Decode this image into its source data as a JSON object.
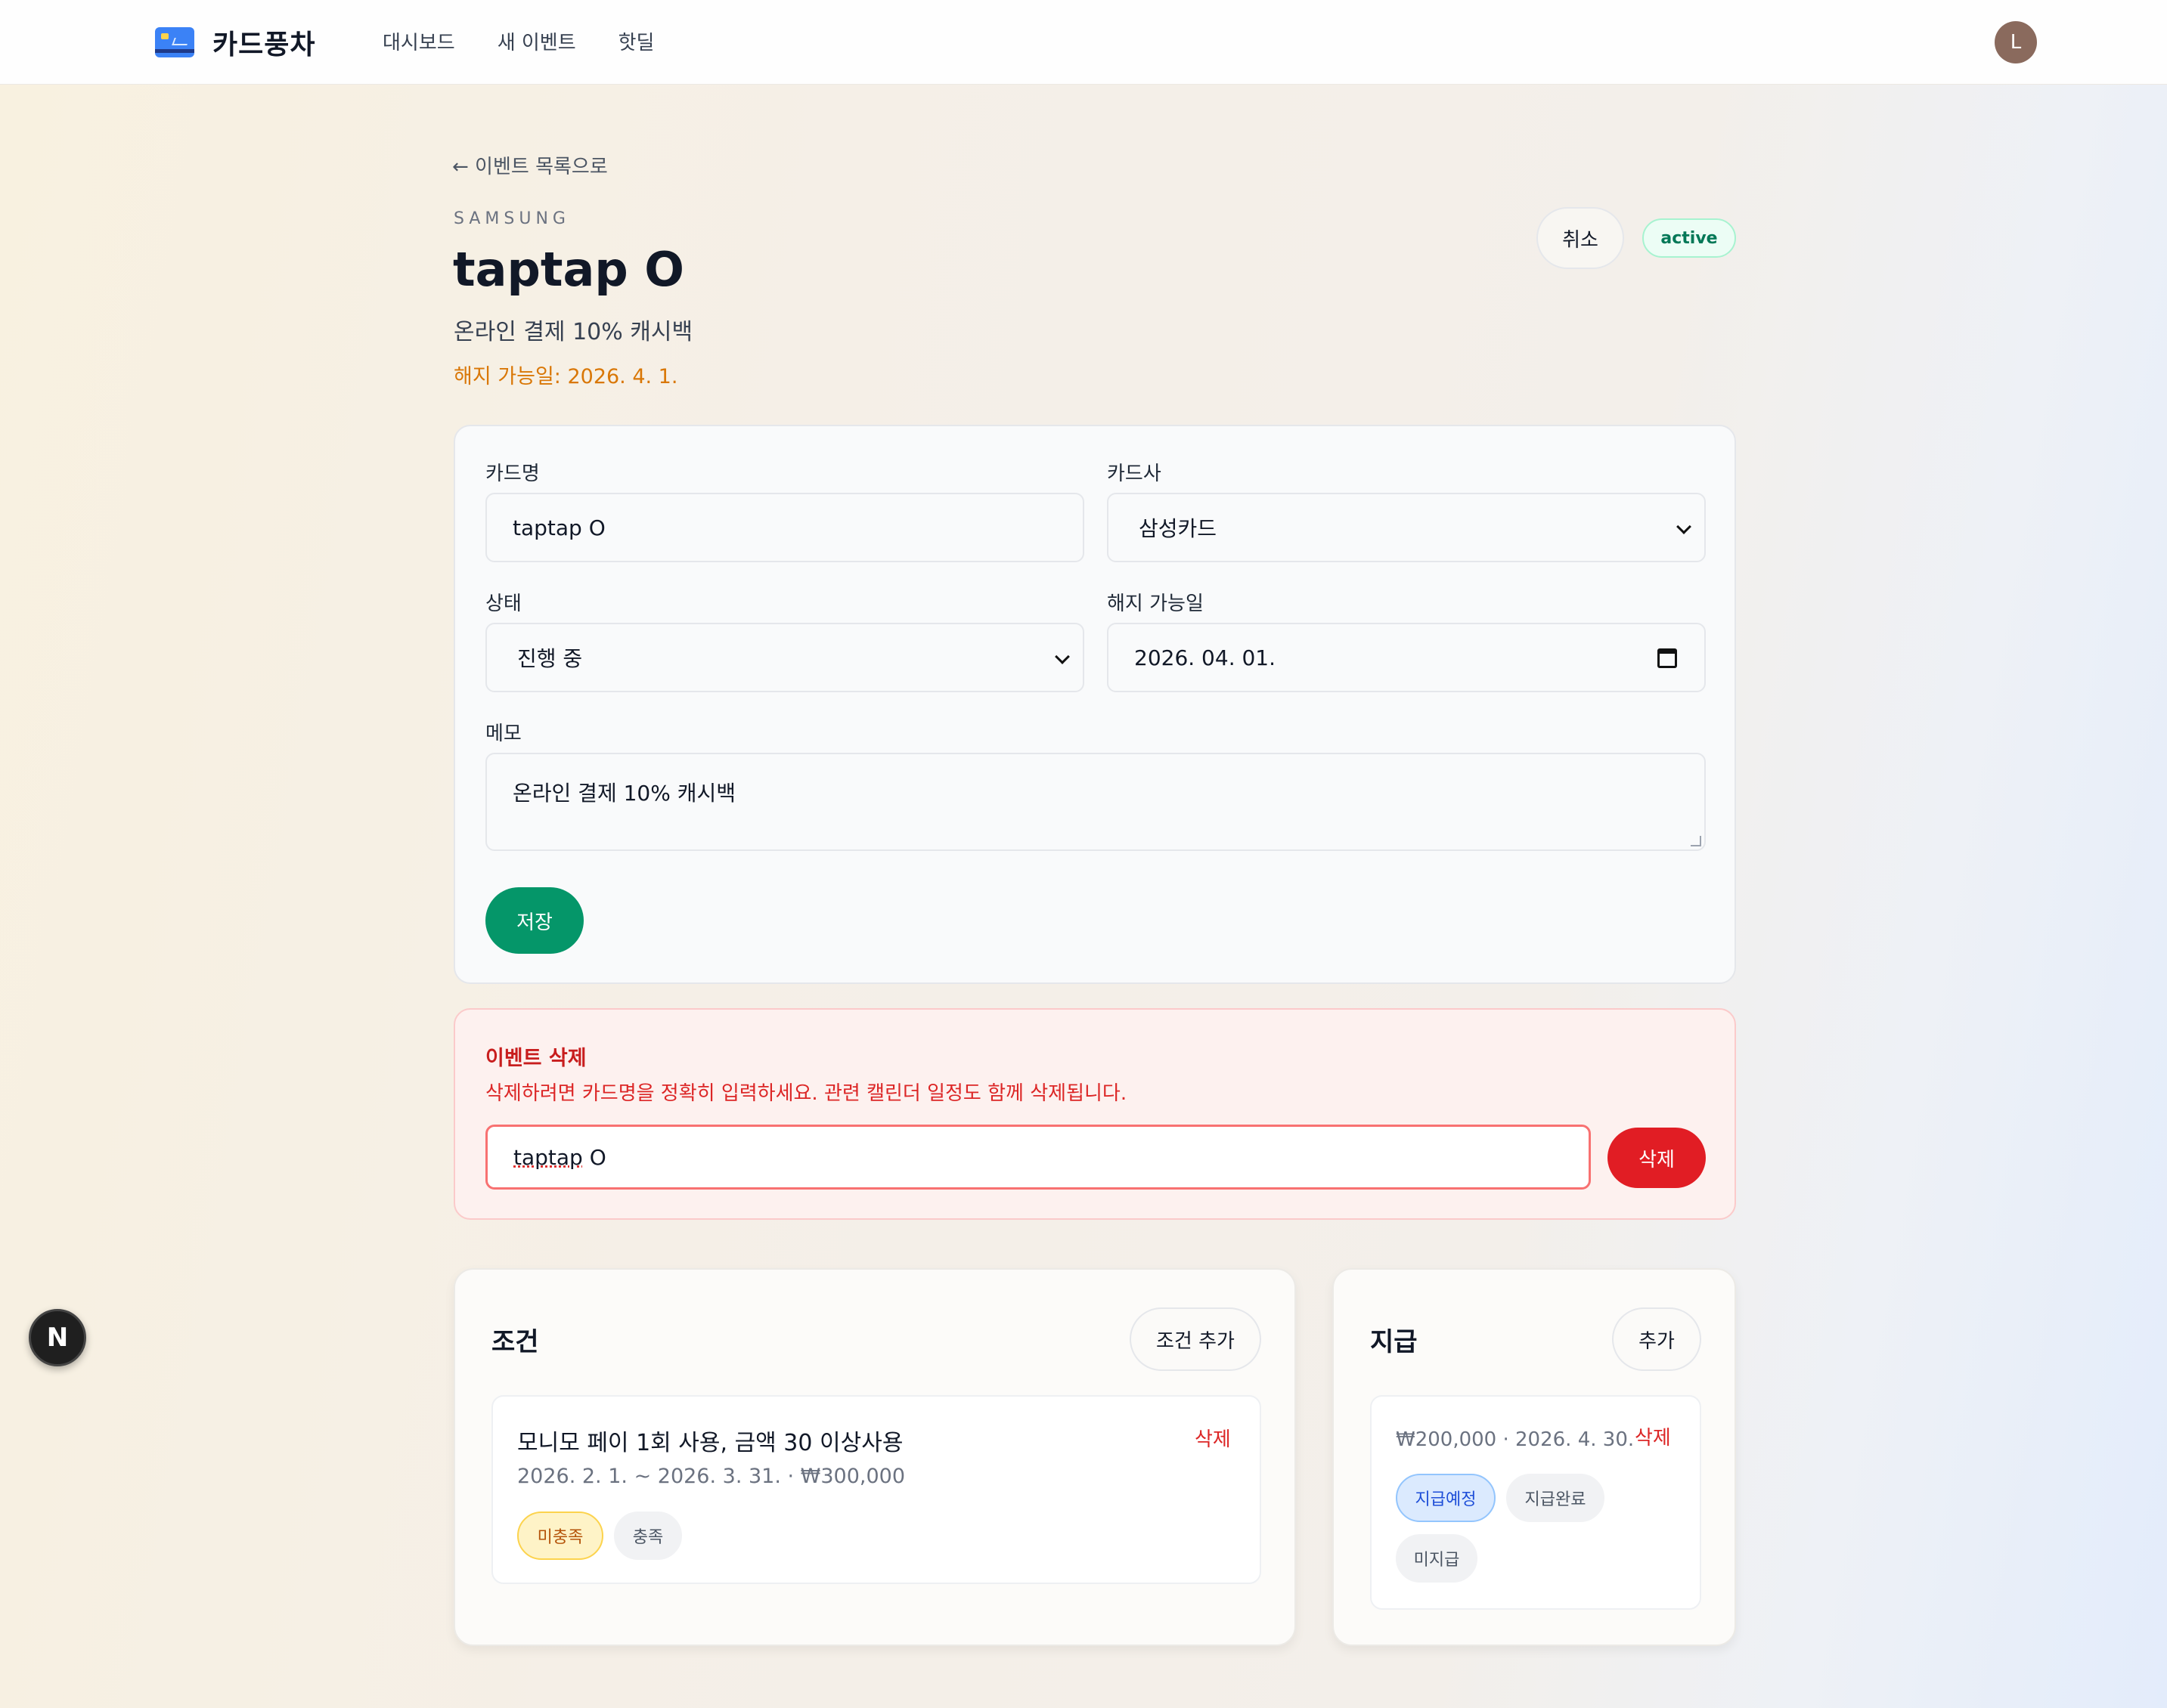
{
  "app": {
    "brand": "카드풍차"
  },
  "nav": {
    "items": [
      "대시보드",
      "새 이벤트",
      "핫딜"
    ]
  },
  "user": {
    "avatar_initial": "L"
  },
  "header": {
    "back_link": "← 이벤트 목록으로",
    "issuer": "SAMSUNG",
    "title": "taptap O",
    "subtitle": "온라인 결제 10% 캐시백",
    "cancel_date": "해지 가능일: 2026. 4. 1.",
    "cancel_button": "취소",
    "status": "active"
  },
  "form": {
    "card_name_label": "카드명",
    "card_name_value": "taptap O",
    "issuer_label": "카드사",
    "issuer_value": "삼성카드",
    "status_label": "상태",
    "status_value": "진행 중",
    "cancel_date_label": "해지 가능일",
    "cancel_date_value": "2026. 04. 01.",
    "memo_label": "메모",
    "memo_value": "온라인 결제 10% 캐시백",
    "save_button": "저장"
  },
  "delete_section": {
    "title": "이벤트 삭제",
    "description": "삭제하려면 카드명을 정확히 입력하세요. 관련 캘린더 일정도 함께 삭제됩니다.",
    "input_value_part1": "taptap",
    "input_value_part2": " O",
    "delete_button": "삭제"
  },
  "conditions": {
    "title": "조건",
    "add_button": "조건 추가",
    "items": [
      {
        "title": "모니모 페이 1회 사용, 금액 30 이상사용",
        "meta": "2026. 2. 1. ~ 2026. 3. 31. · ₩300,000",
        "delete": "삭제",
        "tags": [
          "미충족",
          "충족"
        ]
      }
    ]
  },
  "payouts": {
    "title": "지급",
    "add_button": "추가",
    "items": [
      {
        "meta": "₩200,000 · 2026. 4. 30.",
        "delete": "삭제",
        "tags": [
          "지급예정",
          "지급완료",
          "미지급"
        ]
      }
    ]
  },
  "colors": {
    "accent_green": "#059669",
    "danger_red": "#e11d24",
    "warning_orange": "#d97706"
  }
}
